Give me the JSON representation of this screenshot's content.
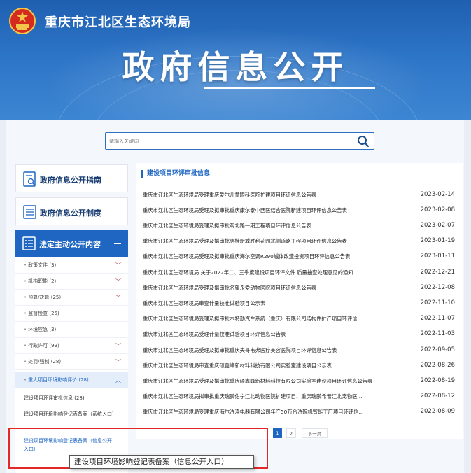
{
  "header": {
    "site_title": "重庆市江北区生态环境局",
    "big_title": "政府信息公开"
  },
  "search": {
    "placeholder": "请输入关键词"
  },
  "sidebar": {
    "guide": "政府信息公开指南",
    "system": "政府信息公开制度",
    "active": "法定主动公开内容",
    "items": [
      "政策文件 (3)",
      "机构职能 (2)",
      "预算/决算 (25)",
      "监督检查 (25)",
      "环境应急 (3)",
      "行政许可 (99)",
      "处罚/强制 (28)",
      "重大项目环境影响评价 (28)"
    ],
    "sub_items": [
      "建设项目环评审批信息 (28)",
      "建设项目环境影响登记表备案（系统入口）",
      "建设项目环境影响登记表备案（信息公开入口）"
    ]
  },
  "content": {
    "heading": "建设项目环评审批信息",
    "rows": [
      {
        "title": "重庆市江北区生态环境局受理重庆爱尔儿童眼科医院扩建项目环评信息公告表",
        "date": "2023-02-14"
      },
      {
        "title": "重庆市江北区生态环境局受理及拟审批重庆康尔泰中西医结合医院新建项目环评信息公告表",
        "date": "2023-02-08"
      },
      {
        "title": "重庆市江北区生态环境局受理及拟审批观北路一期工程项目环评信息公告表",
        "date": "2023-02-07"
      },
      {
        "title": "重庆市江北区生态环境局受理及拟审批唐桂新城胜利花园北侧道路工程项目环评信息公告表",
        "date": "2023-01-19"
      },
      {
        "title": "重庆市江北区生态环境局受理及拟审批重庆海尔空调R290城体改造投资项目环评信息公告表",
        "date": "2023-01-11"
      },
      {
        "title": "重庆市江北区生态环境局 关于2022年二、三季度建设项目环评文件 质量抽查处理意见的通知",
        "date": "2022-12-21"
      },
      {
        "title": "重庆市江北区生态环境局受理及拟审批名望永爱动物医院项目环评信息公告表",
        "date": "2022-12-08"
      },
      {
        "title": "重庆市江北区生态环境局审查计量校准试验项目公示表",
        "date": "2022-11-10"
      },
      {
        "title": "重庆市江北区生态环境局受理及拟审批本特勤汽车系统（重庆）有限公司结构件扩产项目环评信...",
        "date": "2022-11-07"
      },
      {
        "title": "重庆市江北区生态环境局受理计量校准试验项目环评信息公告表",
        "date": "2022-11-03"
      },
      {
        "title": "重庆市江北区生态环境局受理及拟审批重庆夫哥韦弗医疗美容医院项目环评信息公告表",
        "date": "2022-09-05"
      },
      {
        "title": "重庆市江北区生态环境局审查重庆硕鑫峰新材料科技有限公司实验室建设项目公示表",
        "date": "2022-08-26"
      },
      {
        "title": "重庆市江北区生态环境局受理及拟审批重庆硕鑫峰新材料科技有限公司实验室建设项目环评信息公告表",
        "date": "2022-08-19"
      },
      {
        "title": "重庆市江北区生态环境局拟审批重庆瑞鹏佑宁江北动物医院扩建项目、重庆瑞鹏希普江北宠物医...",
        "date": "2022-08-12"
      },
      {
        "title": "重庆市江北区生态环境局受理重庆海尔洗涤电器有限公司年产50万台洗碗机智能工厂项目环评信...",
        "date": "2022-08-09"
      }
    ]
  },
  "pager": {
    "p1": "1",
    "p2": "2",
    "next": "下一页"
  },
  "tooltip": "建设项目环境影响登记表备案（信息公开入口）",
  "colors": {
    "accent": "#1f66c2",
    "highlight_box": "#e32828"
  }
}
